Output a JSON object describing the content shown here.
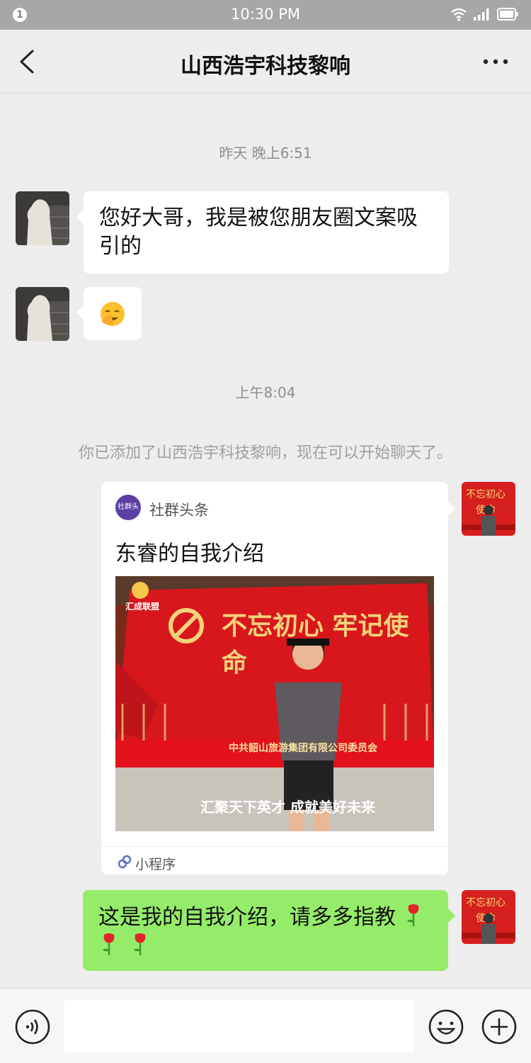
{
  "status_bar": {
    "notification_count": "1",
    "time": "10:30 PM"
  },
  "nav": {
    "title": "山西浩宇科技黎响"
  },
  "timestamps": [
    "昨天 晚上6:51",
    "上午8:04"
  ],
  "system_message": "你已添加了山西浩宇科技黎响，现在可以开始聊天了。",
  "messages": [
    {
      "text": "您好大哥，我是被您朋友圈文案吸引的"
    },
    {
      "text": ""
    },
    {
      "text": "这是我的自我介绍，请多多指教"
    }
  ],
  "card": {
    "source": "社群头条",
    "logo_text": "社群头条",
    "title": "东睿的自我介绍",
    "image_banner": "不忘初心 牢记使命",
    "image_sub": "中共韶山旅游集团有限公司委员会",
    "image_caption": "汇聚天下英才 成就美好未来",
    "image_logo": "汇成联盟",
    "footer": "小程序"
  },
  "colors": {
    "green_bubble": "#95ec69",
    "background": "#ededed"
  }
}
